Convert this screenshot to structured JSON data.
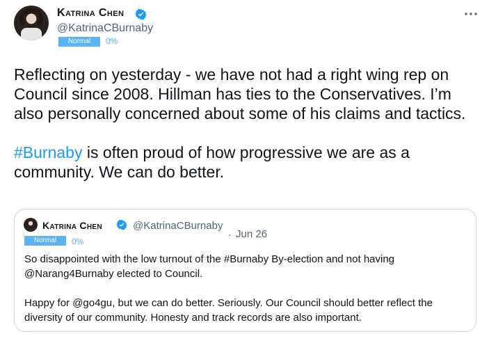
{
  "tweet": {
    "author_name": "Katrina Chen",
    "handle": "@KatrinaCBurnaby",
    "badge_label": "Normal",
    "percent": "0%",
    "paragraph1": "Reflecting on yesterday - we have not had a right wing rep on Council since 2008. Hillman has ties to the Conservatives. I’m also personally concerned about some of his claims and tactics.",
    "hashtag": "#Burnaby",
    "paragraph2_rest": " is often proud of how progressive we are as a community. We can do better."
  },
  "quote": {
    "author_name": "Katrina Chen",
    "handle": "@KatrinaCBurnaby",
    "separator": "·",
    "date": "Jun 26",
    "badge_label": "Normal",
    "percent": "0%",
    "paragraph1": "So disappointed with the low turnout of the #Burnaby By-election and not having @Narang4Burnaby elected to Council.",
    "paragraph2": "Happy for @go4gu, but we can do better. Seriously. Our Council should better reflect the diversity of our community. Honesty and track records are also important."
  },
  "icons": {
    "verified": "verified-badge-icon",
    "more": "more-options-icon"
  },
  "colors": {
    "link": "#1d9bf0",
    "badge": "#58b3f7",
    "secondary_text": "#536471"
  }
}
